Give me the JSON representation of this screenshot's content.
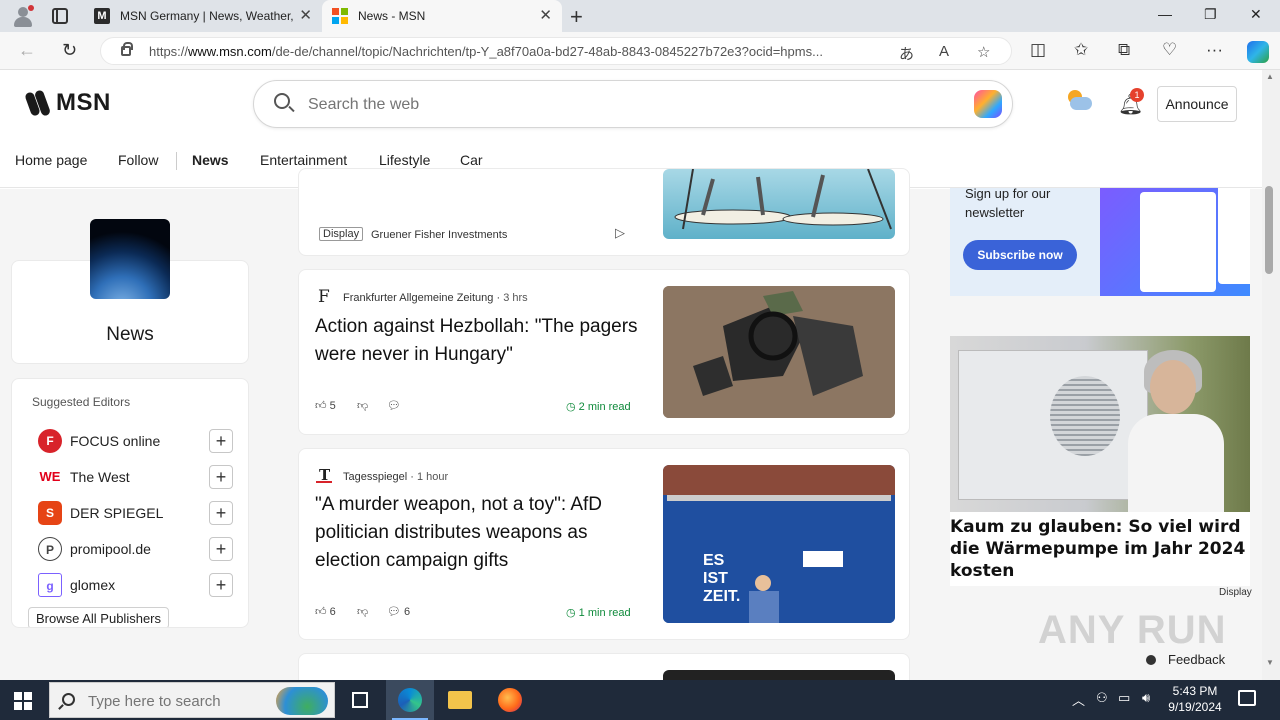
{
  "browser": {
    "tabs": [
      {
        "title": "MSN Germany | News, Weather,",
        "active": false
      },
      {
        "title": "News - MSN",
        "active": true
      }
    ],
    "url_prefix": "https://",
    "url_host": "www.msn.com",
    "url_path": "/de-de/channel/topic/Nachrichten/tp-Y_a8f70a0a-bd27-48ab-8843-0845227b72e3?ocid=hpms..."
  },
  "header": {
    "logo_text": "MSN",
    "search_placeholder": "Search the web",
    "notifications_count": "1",
    "announce_label": "Announce"
  },
  "nav": {
    "items": [
      "Home page",
      "Follow",
      "News",
      "Entertainment",
      "Lifestyle",
      "Car"
    ],
    "active": "News"
  },
  "sidebar": {
    "channel_title": "News",
    "suggested_heading": "Suggested Editors",
    "editors": [
      {
        "name": "FOCUS online",
        "logo": "F",
        "color": "#d8232a"
      },
      {
        "name": "The West",
        "logo": "WE",
        "color": "#e2001a"
      },
      {
        "name": "DER SPIEGEL",
        "logo": "S",
        "color": "#e64415"
      },
      {
        "name": "promipool.de",
        "logo": "P",
        "color": "#444444"
      },
      {
        "name": "glomex",
        "logo": "g",
        "color": "#7b61ff"
      }
    ],
    "browse_label": "Browse All Publishers"
  },
  "feed": {
    "ad_card": {
      "badge": "Display",
      "sponsor": "Gruener Fisher Investments"
    },
    "articles": [
      {
        "source": "Frankfurter Allgemeine Zeitung",
        "age": "3 hrs",
        "title": "Action against Hezbollah: \"The pagers were never in Hungary\"",
        "likes": "5",
        "comments": "",
        "read_time": "2 min read"
      },
      {
        "source": "Tagesspiegel",
        "age": "1 hour",
        "title": "\"A murder weapon, not a toy\": AfD politician distributes weapons as election campaign gifts",
        "likes": "6",
        "comments": "6",
        "read_time": "1 min read"
      }
    ]
  },
  "right_rail": {
    "newsletter_text": "Sign up for our newsletter",
    "newsletter_button": "Subscribe now",
    "ad_headline": "Kaum zu glauben: So viel wird die Wärmepumpe im Jahr 2024 kosten",
    "ad_label": "Display"
  },
  "feedback_label": "Feedback",
  "watermark": "ANY RUN",
  "taskbar": {
    "search_placeholder": "Type here to search",
    "time": "5:43 PM",
    "date": "9/19/2024"
  },
  "colors": {
    "read_time": "#0f8a3b",
    "subscribe_button": "#3a63d8",
    "badge": "#e5412d"
  }
}
